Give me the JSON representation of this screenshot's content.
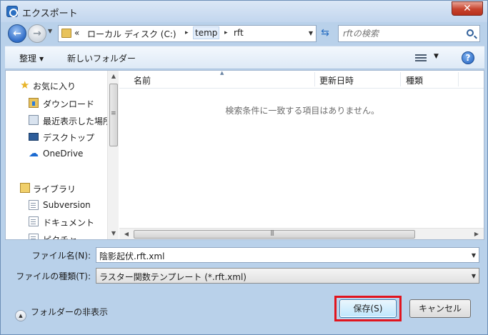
{
  "window": {
    "title": "エクスポート",
    "close_label": "✕"
  },
  "address": {
    "overflow": "«",
    "crumbs": [
      "ローカル ディスク (C:)",
      "temp",
      "rft"
    ],
    "separator": "▸"
  },
  "search": {
    "placeholder": "rftの検索"
  },
  "toolbar": {
    "organize_label": "整理",
    "new_folder_label": "新しいフォルダー",
    "help_label": "?"
  },
  "sidebar": {
    "favorites_label": "お気に入り",
    "favorites": [
      {
        "label": "ダウンロード",
        "icon": "downloads-folder-icon"
      },
      {
        "label": "最近表示した場所",
        "icon": "recent-places-icon"
      },
      {
        "label": "デスクトップ",
        "icon": "desktop-icon"
      },
      {
        "label": "OneDrive",
        "icon": "onedrive-icon"
      }
    ],
    "libraries_label": "ライブラリ",
    "libraries": [
      {
        "label": "Subversion",
        "icon": "document-library-icon"
      },
      {
        "label": "ドキュメント",
        "icon": "document-library-icon"
      },
      {
        "label": "ピクチャ",
        "icon": "picture-library-icon"
      }
    ]
  },
  "file_list": {
    "columns": [
      "名前",
      "更新日時",
      "種類"
    ],
    "empty_message": "検索条件に一致する項目はありません。"
  },
  "form": {
    "filename_label": "ファイル名(N):",
    "filename_value": "陰影起伏.rft.xml",
    "filetype_label": "ファイルの種類(T):",
    "filetype_value": "ラスター関数テンプレート (*.rft.xml)"
  },
  "footer": {
    "hide_folders_label": "フォルダーの非表示",
    "save_label": "保存(S)",
    "cancel_label": "キャンセル"
  },
  "colors": {
    "highlight": "#e1141e",
    "accent": "#2a6fc2"
  }
}
